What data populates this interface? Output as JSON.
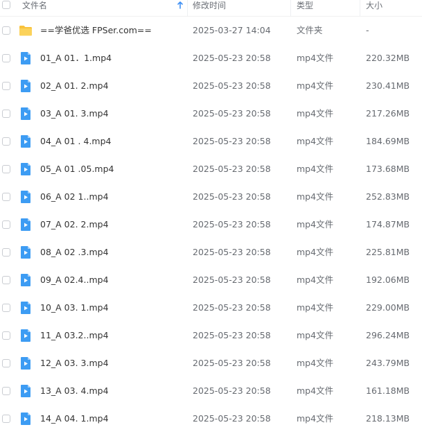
{
  "header": {
    "name_label": "文件名",
    "mtime_label": "修改时间",
    "type_label": "类型",
    "size_label": "大小"
  },
  "colors": {
    "folder": "#f9c23c",
    "video": "#3d9cf3",
    "sort_arrow": "#3d8ff3"
  },
  "icons": {
    "sort": "arrow-up-icon",
    "folder": "folder-icon",
    "video": "video-file-icon"
  },
  "rows": [
    {
      "name": "==学爸优选 FPSer.com==",
      "mtime": "2025-03-27 14:04",
      "type": "文件夹",
      "size": "-",
      "kind": "folder"
    },
    {
      "name": "01_A 01．1.mp4",
      "mtime": "2025-05-23 20:58",
      "type": "mp4文件",
      "size": "220.32MB",
      "kind": "video"
    },
    {
      "name": "02_A 01. 2.mp4",
      "mtime": "2025-05-23 20:58",
      "type": "mp4文件",
      "size": "230.41MB",
      "kind": "video"
    },
    {
      "name": "03_A 01. 3.mp4",
      "mtime": "2025-05-23 20:58",
      "type": "mp4文件",
      "size": "217.26MB",
      "kind": "video"
    },
    {
      "name": "04_A 01 . 4.mp4",
      "mtime": "2025-05-23 20:58",
      "type": "mp4文件",
      "size": "184.69MB",
      "kind": "video"
    },
    {
      "name": "05_A 01 .05.mp4",
      "mtime": "2025-05-23 20:58",
      "type": "mp4文件",
      "size": "173.68MB",
      "kind": "video"
    },
    {
      "name": "06_A 02 1..mp4",
      "mtime": "2025-05-23 20:58",
      "type": "mp4文件",
      "size": "252.83MB",
      "kind": "video"
    },
    {
      "name": "07_A 02. 2.mp4",
      "mtime": "2025-05-23 20:58",
      "type": "mp4文件",
      "size": "174.87MB",
      "kind": "video"
    },
    {
      "name": "08_A 02 .3.mp4",
      "mtime": "2025-05-23 20:58",
      "type": "mp4文件",
      "size": "225.81MB",
      "kind": "video"
    },
    {
      "name": "09_A 02.4..mp4",
      "mtime": "2025-05-23 20:58",
      "type": "mp4文件",
      "size": "192.06MB",
      "kind": "video"
    },
    {
      "name": "10_A 03. 1.mp4",
      "mtime": "2025-05-23 20:58",
      "type": "mp4文件",
      "size": "229.00MB",
      "kind": "video"
    },
    {
      "name": "11_A 03.2..mp4",
      "mtime": "2025-05-23 20:58",
      "type": "mp4文件",
      "size": "296.24MB",
      "kind": "video"
    },
    {
      "name": "12_A 03. 3.mp4",
      "mtime": "2025-05-23 20:58",
      "type": "mp4文件",
      "size": "243.79MB",
      "kind": "video"
    },
    {
      "name": "13_A 03. 4.mp4",
      "mtime": "2025-05-23 20:58",
      "type": "mp4文件",
      "size": "161.18MB",
      "kind": "video"
    },
    {
      "name": "14_A 04. 1.mp4",
      "mtime": "2025-05-23 20:58",
      "type": "mp4文件",
      "size": "218.13MB",
      "kind": "video"
    }
  ]
}
